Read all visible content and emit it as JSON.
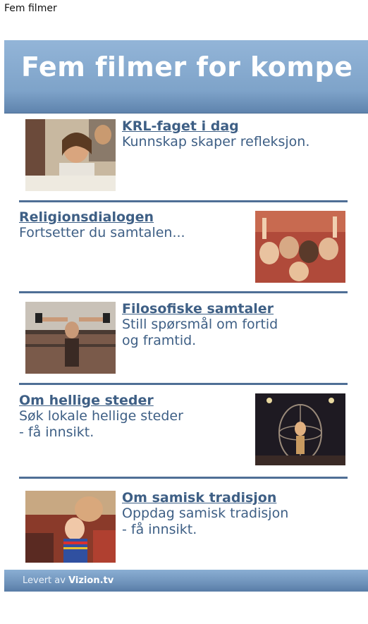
{
  "page": {
    "title": "Fem filmer"
  },
  "banner": {
    "text": "Fem filmer for kompe"
  },
  "items": [
    {
      "title": "KRL-faget i dag",
      "desc": "Kunnskap skaper refleksjon."
    },
    {
      "title": "Religionsdialogen",
      "desc": "Fortsetter du samtalen..."
    },
    {
      "title": "Filosofiske samtaler",
      "desc": "Still spørsmål om fortid\nog framtid."
    },
    {
      "title": "Om hellige steder",
      "desc": "Søk lokale hellige steder\n- få innsikt."
    },
    {
      "title": "Om samisk tradisjon",
      "desc": "Oppdag samisk tradisjon\n- få innsikt."
    }
  ],
  "footer": {
    "prefix": "Levert av",
    "brand": "Vizion.tv"
  },
  "colors": {
    "link": "#3e5f85",
    "banner": "#7ea3c9",
    "divider": "#4f6f96"
  }
}
